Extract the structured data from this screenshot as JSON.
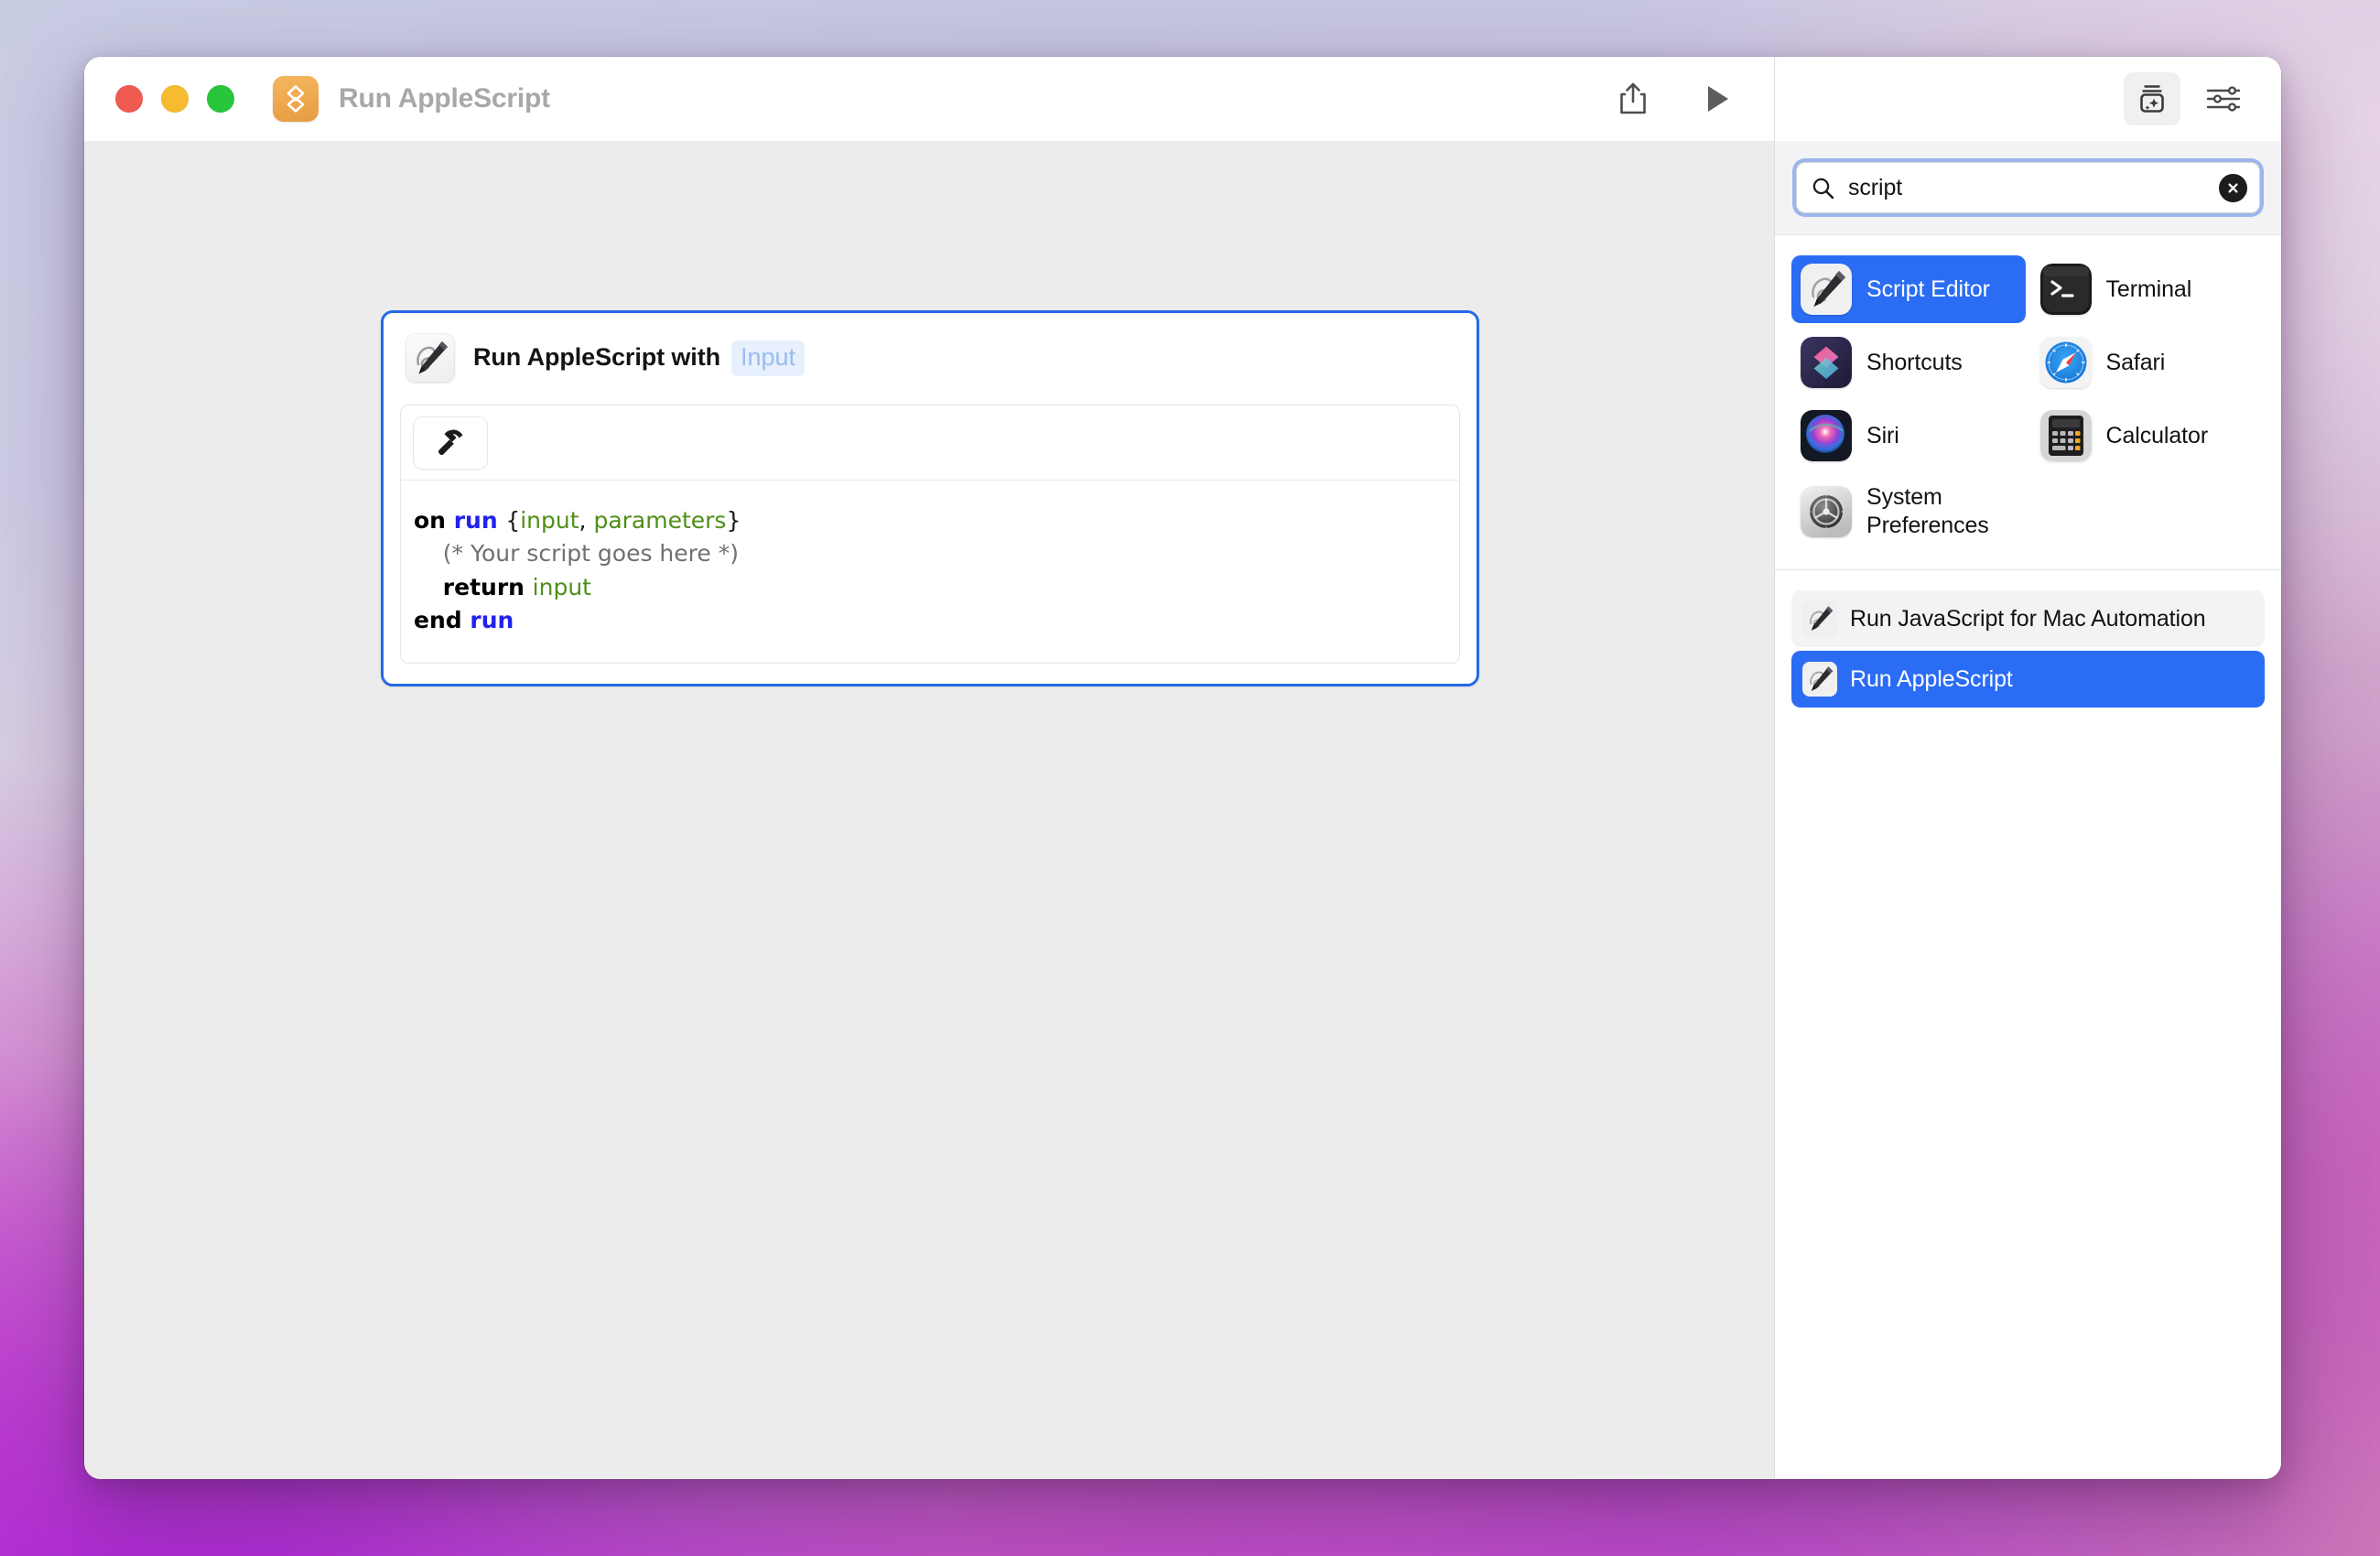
{
  "window": {
    "title": "Run AppleScript",
    "app_icon": "automator-icon",
    "traffic_lights": [
      "close-button",
      "minimize-button",
      "zoom-button"
    ],
    "colors": {
      "accent_blue": "#2a6cf4",
      "card_border": "#2569e8",
      "token_text": "#9bbcf0",
      "token_bg": "#e8f0fd",
      "app_icon_orange": "#e79c42"
    }
  },
  "toolbar": {
    "share_label": "Share",
    "run_label": "Run",
    "library_label": "Action Library",
    "variables_label": "Variables"
  },
  "action_card": {
    "title": "Run AppleScript with",
    "input_token": "Input",
    "icon": "script-editor-icon",
    "toolbar": {
      "compile_label": "Compile"
    },
    "code_lines": [
      {
        "tokens": [
          {
            "t": "on ",
            "c": "kw"
          },
          {
            "t": "run ",
            "c": "fn"
          },
          {
            "t": "{",
            "c": "pun"
          },
          {
            "t": "input",
            "c": "var"
          },
          {
            "t": ", ",
            "c": "pun"
          },
          {
            "t": "parameters",
            "c": "var"
          },
          {
            "t": "}",
            "c": "pun"
          }
        ]
      },
      {
        "tokens": [
          {
            "t": "    (* Your script goes here *)",
            "c": "cmt"
          }
        ]
      },
      {
        "tokens": [
          {
            "t": "    ",
            "c": "pun"
          },
          {
            "t": "return ",
            "c": "kw"
          },
          {
            "t": "input",
            "c": "var"
          }
        ]
      },
      {
        "tokens": [
          {
            "t": "end ",
            "c": "kw"
          },
          {
            "t": "run",
            "c": "fn"
          }
        ]
      }
    ]
  },
  "sidebar": {
    "search": {
      "value": "script",
      "placeholder": "Search",
      "search_icon": "search-icon",
      "clear_icon": "clear-icon"
    },
    "apps": [
      {
        "label": "Script Editor",
        "icon": "script-editor-icon",
        "selected": true
      },
      {
        "label": "Terminal",
        "icon": "terminal-icon",
        "selected": false
      },
      {
        "label": "Shortcuts",
        "icon": "shortcuts-icon",
        "selected": false
      },
      {
        "label": "Safari",
        "icon": "safari-icon",
        "selected": false
      },
      {
        "label": "Siri",
        "icon": "siri-icon",
        "selected": false
      },
      {
        "label": "Calculator",
        "icon": "calculator-icon",
        "selected": false
      },
      {
        "label": "System Preferences",
        "icon": "system-preferences-icon",
        "selected": false
      }
    ],
    "actions": [
      {
        "label": "Run JavaScript for Mac Automation",
        "icon": "script-editor-icon",
        "state": "hover"
      },
      {
        "label": "Run AppleScript",
        "icon": "script-editor-icon",
        "state": "selected"
      }
    ]
  }
}
